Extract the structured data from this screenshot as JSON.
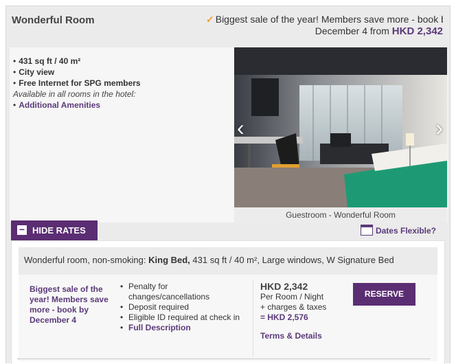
{
  "header": {
    "room_title": "Wonderful Room",
    "promo_text": "Biggest sale of the year! Members save more - book by",
    "promo_line2": "December 4 from",
    "promo_price": "HKD 2,342"
  },
  "features": {
    "items": [
      "431 sq ft / 40 m²",
      "City view",
      "Free Internet for SPG members"
    ],
    "available_note": "Available in all rooms in the hotel:",
    "amenities_link": "Additional Amenities"
  },
  "photo": {
    "caption": "Guestroom - Wonderful Room"
  },
  "controls": {
    "hide_rates_label": "HIDE RATES",
    "dates_flexible": "Dates Flexible?"
  },
  "rate": {
    "description_prefix": "Wonderful room, non-smoking: ",
    "bed": "King Bed,",
    "description_suffix": " 431 sq ft / 40 m², Large windows, W Signature Bed",
    "name": "Biggest sale of the year! Members save more - book by December 4",
    "policies": [
      "Penalty for changes/cancellations",
      "Deposit required",
      "Eligible ID required at check in"
    ],
    "full_description": "Full Description",
    "price": "HKD 2,342",
    "per_room": "Per Room / Night",
    "charges": "+ charges & taxes",
    "total_prefix": "= ",
    "total": "HKD 2,576",
    "terms": "Terms & Details",
    "reserve_label": "RESERVE"
  },
  "colors": {
    "brand_purple": "#5b2d72",
    "link_purple": "#5b3a7a",
    "check_orange": "#f0a030"
  }
}
